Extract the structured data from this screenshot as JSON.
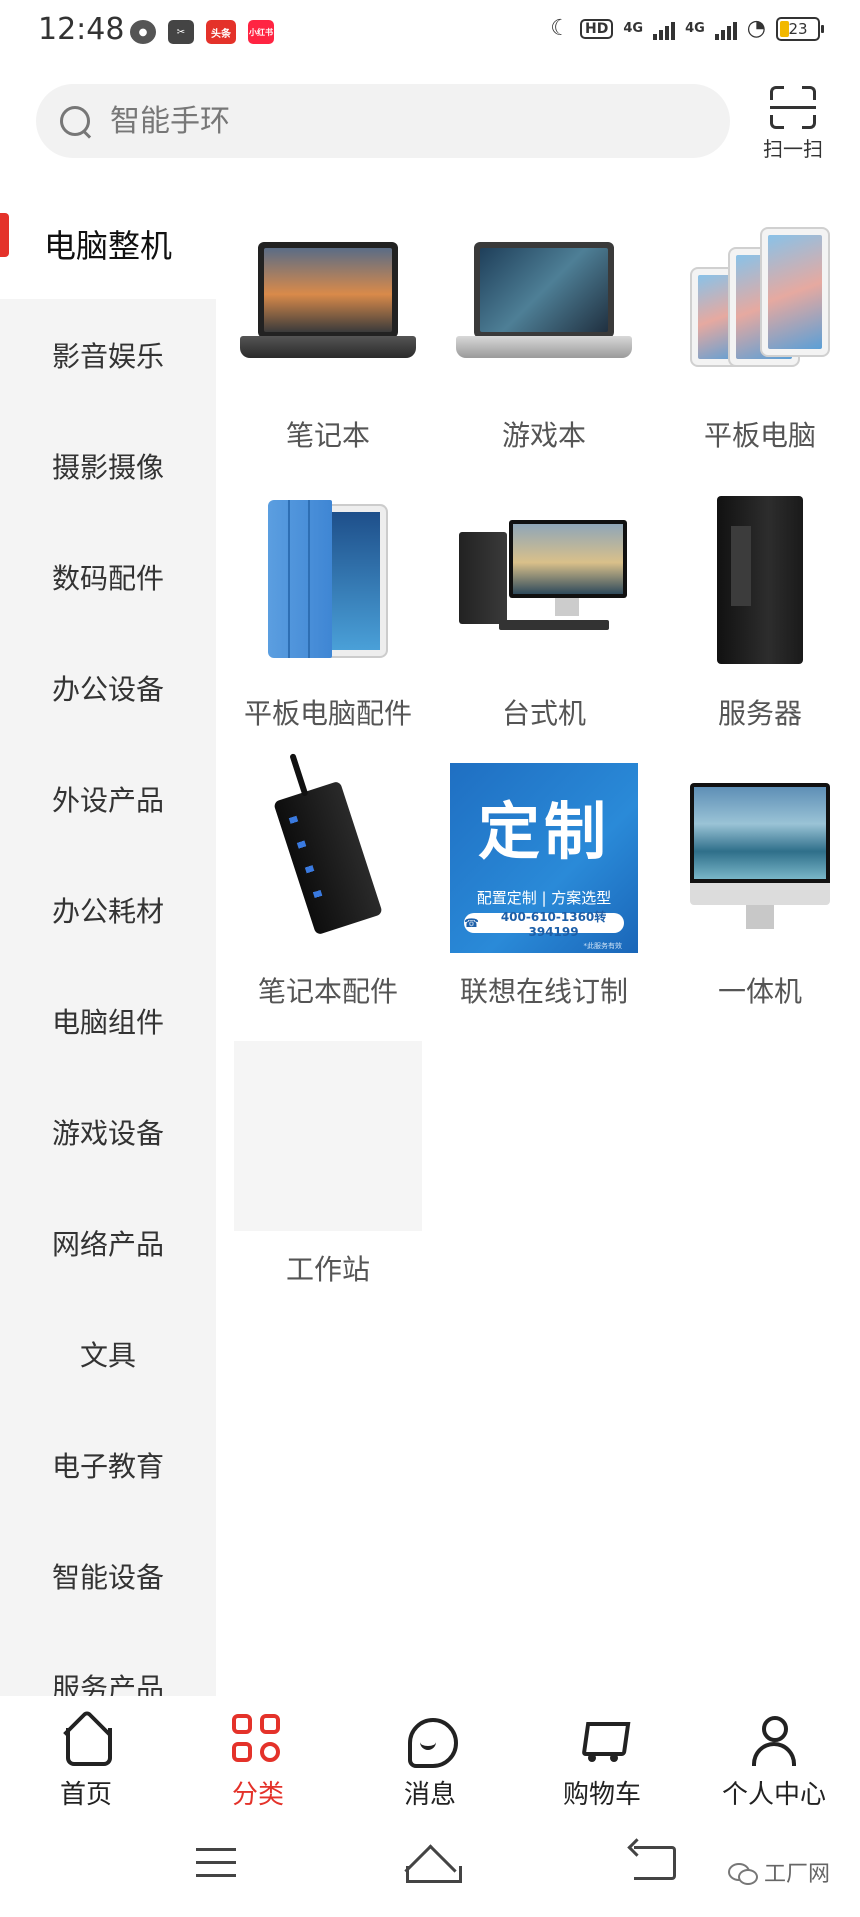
{
  "status_bar": {
    "time": "12:48",
    "app_icons": [
      "wechat-icon",
      "scissors-app-icon",
      "toutiao-icon",
      "xiaohongshu-icon"
    ],
    "app_badges": [
      "头条",
      "小红书"
    ],
    "hd_label": "HD",
    "network_1": "4G",
    "network_2": "4G",
    "battery": "23"
  },
  "search": {
    "placeholder": "智能手环",
    "scan_label": "扫一扫"
  },
  "sidebar": {
    "items": [
      {
        "label": "电脑整机",
        "active": true
      },
      {
        "label": "影音娱乐"
      },
      {
        "label": "摄影摄像"
      },
      {
        "label": "数码配件"
      },
      {
        "label": "办公设备"
      },
      {
        "label": "外设产品"
      },
      {
        "label": "办公耗材"
      },
      {
        "label": "电脑组件"
      },
      {
        "label": "游戏设备"
      },
      {
        "label": "网络产品"
      },
      {
        "label": "文具"
      },
      {
        "label": "电子教育"
      },
      {
        "label": "智能设备"
      },
      {
        "label": "服务产品"
      }
    ]
  },
  "grid": {
    "items": [
      {
        "label": "笔记本",
        "image": "laptop-image"
      },
      {
        "label": "游戏本",
        "image": "gaming-laptop-image"
      },
      {
        "label": "平板电脑",
        "image": "tablet-image"
      },
      {
        "label": "平板电脑配件",
        "image": "tablet-cover-image"
      },
      {
        "label": "台式机",
        "image": "desktop-image"
      },
      {
        "label": "服务器",
        "image": "server-image"
      },
      {
        "label": "笔记本配件",
        "image": "usb-hub-image"
      },
      {
        "label": "联想在线订制",
        "image": "custom-banner-image"
      },
      {
        "label": "一体机",
        "image": "all-in-one-image"
      },
      {
        "label": "工作站",
        "image": "blank-image"
      }
    ],
    "custom_banner": {
      "title": "定制",
      "subtitle": "配置定制 | 方案选型",
      "phone": "400-610-1360转394199",
      "note": "*此服务有效"
    }
  },
  "tabbar": {
    "items": [
      {
        "label": "首页",
        "icon": "home-icon"
      },
      {
        "label": "分类",
        "icon": "category-icon",
        "active": true
      },
      {
        "label": "消息",
        "icon": "message-icon"
      },
      {
        "label": "购物车",
        "icon": "cart-icon"
      },
      {
        "label": "个人中心",
        "icon": "user-icon"
      }
    ]
  },
  "watermark": "工厂网",
  "colors": {
    "accent": "#e4322a",
    "sidebar_bg": "#f4f4f4",
    "search_bg": "#f2f2f2"
  }
}
